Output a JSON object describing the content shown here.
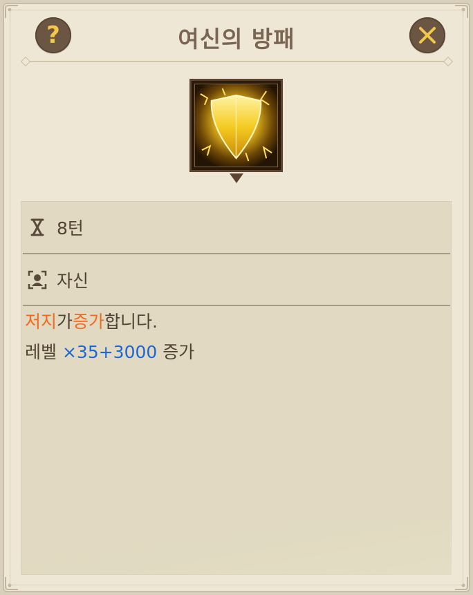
{
  "dialog": {
    "title": "여신의 방패",
    "help_label": "?",
    "close_icon": "close-x-icon",
    "skill_icon": "golden-shield-icon"
  },
  "info": {
    "duration": {
      "icon": "hourglass-icon",
      "text": "8턴"
    },
    "target": {
      "icon": "target-self-icon",
      "text": "자신"
    },
    "effect_line1": {
      "stat": "저지",
      "particle": "가",
      "verb": "증가",
      "ending": "합니다."
    },
    "effect_line2": {
      "prefix": "레벨",
      "formula": "×35+3000",
      "suffix": "증가"
    }
  },
  "colors": {
    "highlight_orange": "#f26a1e",
    "highlight_blue": "#1b67d6",
    "button_bg": "#6b5643",
    "button_glyph": "#f4c64b"
  }
}
